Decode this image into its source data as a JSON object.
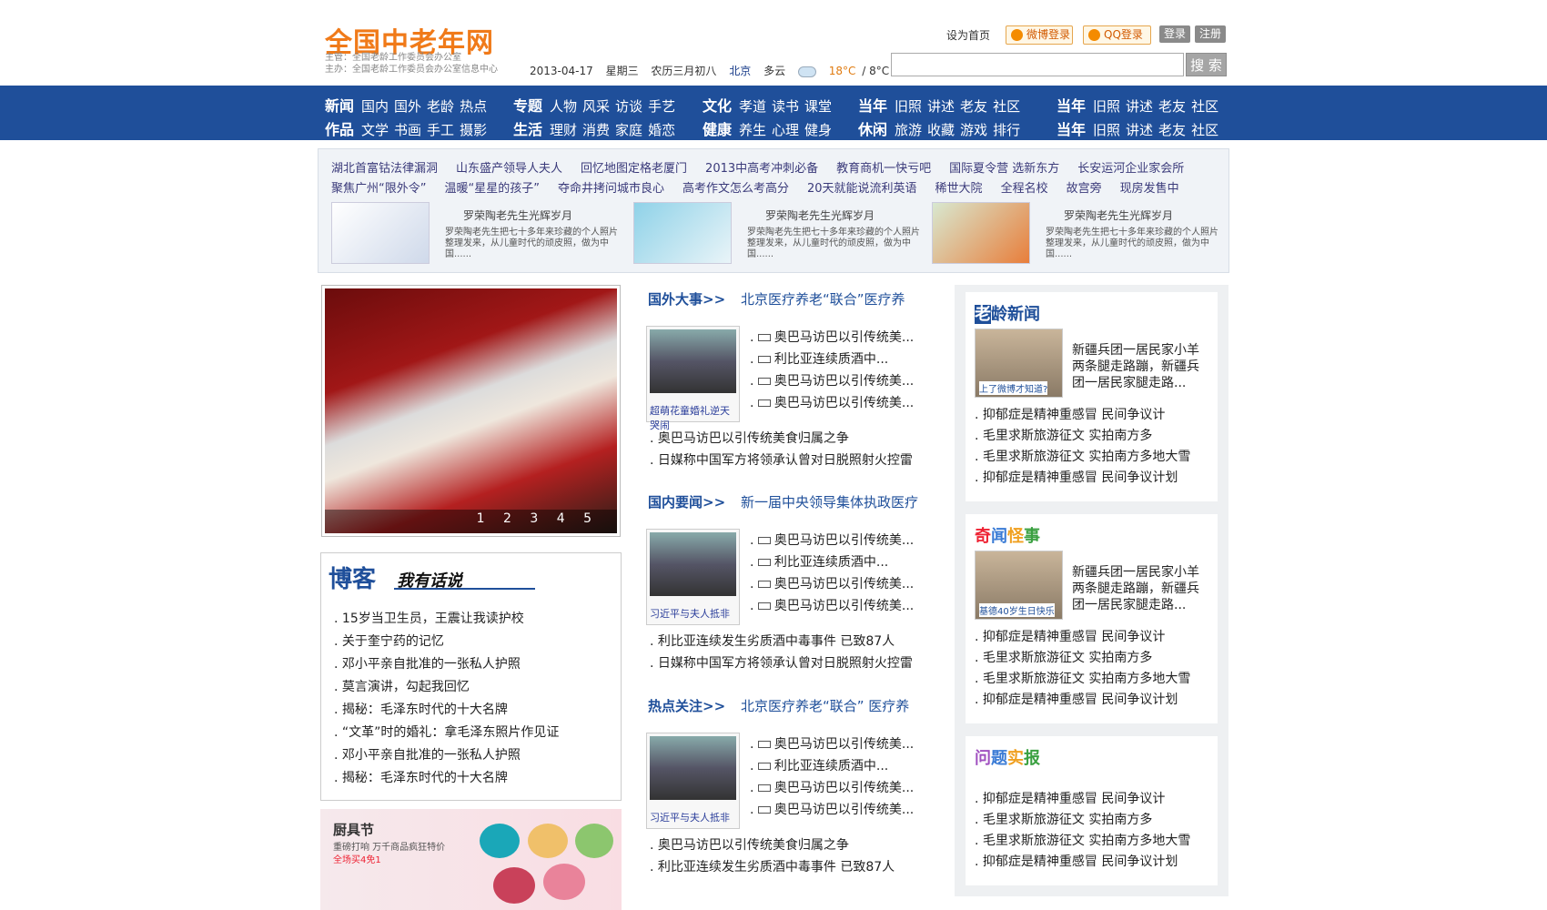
{
  "header": {
    "logo": "全国中老年网",
    "sponsor_line1": "主管：全国老龄工作委员会办公室",
    "sponsor_line2": "主办：全国老龄工作委员会办公室信息中心",
    "date": "2013-04-17",
    "weekday": "星期三",
    "lunar": "农历三月初八",
    "city": "北京",
    "weather": "多云",
    "temp_high": "18°C",
    "temp_low": "/ 8°C",
    "set_home": "设为首页",
    "weibo_login": "微博登录",
    "qq_login": "QQ登录",
    "login": "登录",
    "register": "注册",
    "search_button": "搜 索",
    "search_value": ""
  },
  "nav": [
    {
      "row1": {
        "head": "新闻",
        "items": [
          "国内",
          "国外",
          "老龄",
          "热点"
        ]
      },
      "row2": {
        "head": "作品",
        "items": [
          "文学",
          "书画",
          "手工",
          "摄影"
        ]
      }
    },
    {
      "row1": {
        "head": "专题",
        "items": [
          "人物",
          "风采",
          "访谈",
          "手艺"
        ]
      },
      "row2": {
        "head": "生活",
        "items": [
          "理财",
          "消费",
          "家庭",
          "婚恋"
        ]
      }
    },
    {
      "row1": {
        "head": "文化",
        "items": [
          "孝道",
          "读书",
          "课堂"
        ]
      },
      "row2": {
        "head": "健康",
        "items": [
          "养生",
          "心理",
          "健身"
        ]
      }
    },
    {
      "row1": {
        "head": "当年",
        "items": [
          "旧照",
          "讲述",
          "老友",
          "社区"
        ]
      },
      "row2": {
        "head": "休闲",
        "items": [
          "旅游",
          "收藏",
          "游戏",
          "排行"
        ]
      }
    },
    {
      "row1": {
        "head": "当年",
        "items": [
          "旧照",
          "讲述",
          "老友",
          "社区"
        ]
      },
      "row2": {
        "head": "当年",
        "items": [
          "旧照",
          "讲述",
          "老友",
          "社区"
        ]
      }
    }
  ],
  "ads": {
    "line1": [
      "湖北首富钴法律漏洞",
      "山东盛产领导人夫人",
      "回忆地图定格老厦门",
      "2013中高考冲刺必备",
      "教育商机一快亏吧",
      "国际夏令营 选新东方",
      "长安运河企业家会所"
    ],
    "line2": [
      "聚焦广州“限外令”",
      "温暖“星星的孩子”",
      "夺命井拷问城市良心",
      "高考作文怎么考高分",
      "20天就能说流利英语",
      "稀世大院",
      "全程名校",
      "故宫旁",
      "现房发售中"
    ],
    "products": [
      {
        "title": "罗荣陶老先生光辉岁月",
        "desc": "罗荣陶老先生把七十多年来珍藏的个人照片整理发来，从儿童时代的顽皮照，做为中国......"
      },
      {
        "title": "罗荣陶老先生光辉岁月",
        "desc": "罗荣陶老先生把七十多年来珍藏的个人照片整理发来，从儿童时代的顽皮照，做为中国......"
      },
      {
        "title": "罗荣陶老先生光辉岁月",
        "desc": "罗荣陶老先生把七十多年来珍藏的个人照片整理发来，从儿童时代的顽皮照，做为中国......"
      }
    ]
  },
  "slider": {
    "nums": "1 2 3 4 5"
  },
  "blog": {
    "title": "博客",
    "subtitle": "我有话说",
    "items": [
      "15岁当卫生员，王震让我读护校",
      "关于奎宁药的记忆",
      "邓小平亲自批准的一张私人护照",
      "莫言演讲，勾起我回忆",
      "揭秘：毛泽东时代的十大名牌",
      "“文革”时的婚礼：拿毛泽东照片作见证",
      "邓小平亲自批准的一张私人护照",
      "揭秘：毛泽东时代的十大名牌"
    ]
  },
  "kitchen": {
    "title": "厨具节",
    "sub": "重磅打响 万千商品疯狂特价",
    "promo": "全场买4免1"
  },
  "sections": [
    {
      "head": "国外大事>>",
      "headline": "北京医疗养老“联合”医疗养",
      "caption": "超萌花童婚礼逆天哭闹",
      "videos": [
        "奥巴马访巴以引传统美...",
        "利比亚连续质酒中...",
        "奥巴马访巴以引传统美...",
        "奥巴马访巴以引传统美..."
      ],
      "texts": [
        "奥巴马访巴以引传统美食归属之争",
        "日媒称中国军方将领承认曾对日脱照射火控雷"
      ]
    },
    {
      "head": "国内要闻>>",
      "headline": "新一届中央领导集体执政医疗",
      "caption": "习近平与夫人抵非",
      "videos": [
        "奥巴马访巴以引传统美...",
        "利比亚连续质酒中...",
        "奥巴马访巴以引传统美...",
        "奥巴马访巴以引传统美..."
      ],
      "texts": [
        "利比亚连续发生劣质酒中毒事件 已致87人",
        "日媒称中国军方将领承认曾对日脱照射火控雷"
      ]
    },
    {
      "head": "热点关注>>",
      "headline": "北京医疗养老“联合” 医疗养",
      "caption": "习近平与夫人抵非",
      "videos": [
        "奥巴马访巴以引传统美...",
        "利比亚连续质酒中...",
        "奥巴马访巴以引传统美...",
        "奥巴马访巴以引传统美..."
      ],
      "texts": [
        "奥巴马访巴以引传统美食归属之争",
        "利比亚连续发生劣质酒中毒事件 已致87人"
      ]
    }
  ],
  "right": [
    {
      "title": "老龄新闻",
      "thumb": "上了微博才知道?",
      "text": "新疆兵团一居民家小羊两条腿走路蹦，新疆兵团一居民家腿走路...",
      "items": [
        "抑郁症是精神重感冒 民间争议计",
        "毛里求斯旅游征文 实拍南方多",
        "毛里求斯旅游征文 实拍南方多地大雪",
        "抑郁症是精神重感冒 民间争议计划"
      ]
    },
    {
      "title": "奇闻怪事",
      "thumb": "基德40岁生日快乐",
      "text": "新疆兵团一居民家小羊两条腿走路蹦，新疆兵团一居民家腿走路...",
      "items": [
        "抑郁症是精神重感冒 民间争议计",
        "毛里求斯旅游征文 实拍南方多",
        "毛里求斯旅游征文 实拍南方多地大雪",
        "抑郁症是精神重感冒 民间争议计划"
      ]
    },
    {
      "title": "问题实报",
      "items": [
        "抑郁症是精神重感冒 民间争议计",
        "毛里求斯旅游征文 实拍南方多",
        "毛里求斯旅游征文 实拍南方多地大雪",
        "抑郁症是精神重感冒 民间争议计划"
      ]
    }
  ]
}
